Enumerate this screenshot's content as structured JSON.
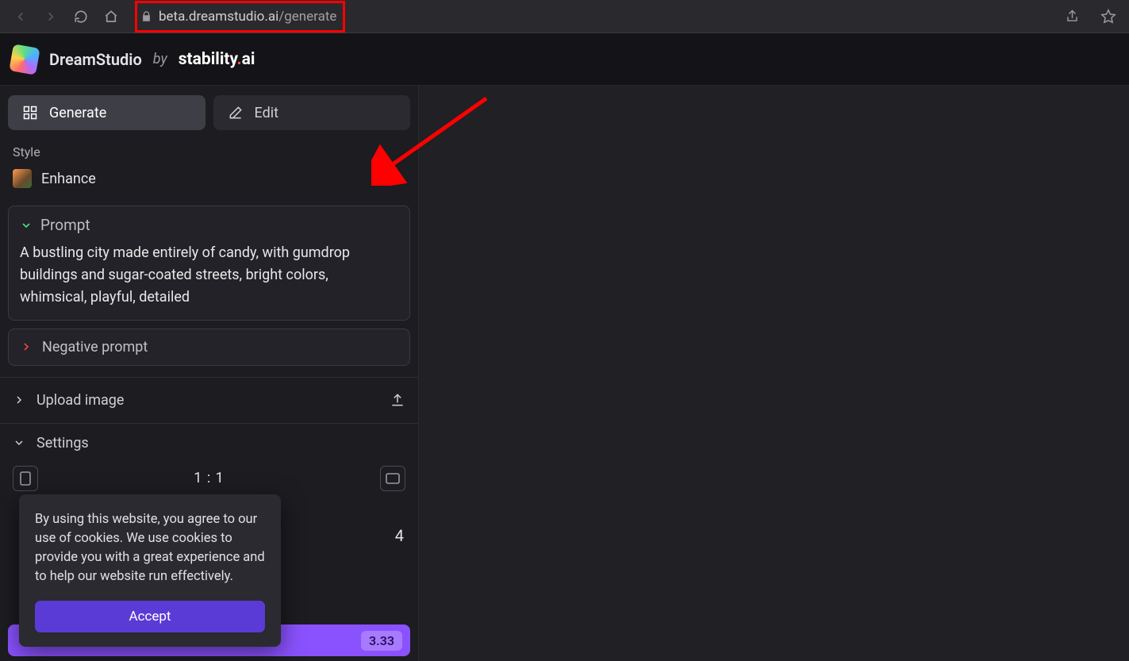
{
  "browser": {
    "url_host": "beta.dreamstudio.ai",
    "url_path": "/generate"
  },
  "header": {
    "product": "DreamStudio",
    "by": "by",
    "company_main": "stability",
    "company_dot": ".",
    "company_tld": "ai"
  },
  "tabs": {
    "generate": "Generate",
    "edit": "Edit"
  },
  "style": {
    "label": "Style",
    "value": "Enhance"
  },
  "prompt": {
    "header": "Prompt",
    "text": "A bustling city made entirely of candy, with gumdrop buildings and sugar-coated streets, bright colors, whimsical, playful, detailed"
  },
  "negative_prompt": {
    "label": "Negative prompt"
  },
  "upload": {
    "label": "Upload image"
  },
  "settings": {
    "label": "Settings",
    "ratio": "1 : 1",
    "count": "4"
  },
  "cookie": {
    "text": "By using this website, you agree to our use of cookies. We use cookies to provide you with a great experience and to help our website run effectively.",
    "accept": "Accept"
  },
  "dream": {
    "credits": "3.33"
  }
}
